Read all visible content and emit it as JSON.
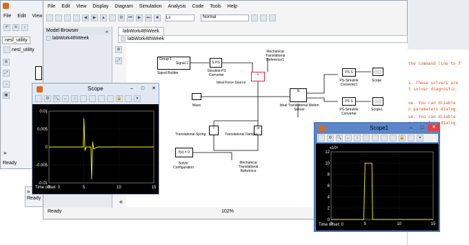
{
  "small_window": {
    "menu": [
      "File",
      "Edit",
      "View"
    ],
    "tab_nesl": "nesl_utility",
    "tree_item": "nesl_utility",
    "status": "Ready"
  },
  "simulink": {
    "menu": [
      "File",
      "Edit",
      "View",
      "Display",
      "Diagram",
      "Simulation",
      "Analysis",
      "Code",
      "Tools",
      "Help"
    ],
    "sim_time": "Ls",
    "sim_mode": "Normal",
    "model_browser_title": "Model Browser",
    "browser_item": "labWork4thWeek",
    "tab": "labWork4thWeek",
    "breadcrumb": "labWork4thWeek",
    "status": "Ready",
    "zoom": "102%",
    "blocks": {
      "group_label": "Group 1",
      "signal_label": "Signal 1",
      "signal_builder": "Signal Builder",
      "s_ps": "S PS",
      "s_ps_conv": "Simulink-PS Converter",
      "mech_ref1": "Mechanical Translational Reference1",
      "ideal_force": "Ideal Force Source",
      "mass": "Mass",
      "sensor": "Ideal Translational Motion Sensor",
      "ps_s1": "PS S",
      "ps_s1_conv": "PS-Simulink Converter1",
      "ps_s2": "PS S",
      "ps_s2_conv": "PS-Simulink Converter",
      "scope": "Scope",
      "scope1": "Scope1",
      "spring": "Translational Spring",
      "damper": "Translational Damper",
      "fx": "f(x) = 0",
      "solver": "Solver Configuration",
      "mech_ref": "Mechanical Translational Reference"
    }
  },
  "console": {
    "lines": [
      {
        "text": "the command line to f",
        "top": 89
      },
      {
        "text": "s. These solvers are",
        "top": 117
      },
      {
        "text": "t solver diagnostic",
        "top": 126
      },
      {
        "text": "ue.  You can disable",
        "top": 146
      },
      {
        "text": "n parameters dialog",
        "top": 155
      },
      {
        "text": "ue.  You can disable",
        "top": 166
      },
      {
        "text": "n parameters dialog",
        "top": 175
      }
    ],
    "gray_line": "ie.  You can disable"
  },
  "scope": {
    "title": "Scope",
    "yticks": [
      "0.01",
      "0.005",
      "0",
      "-0.005",
      "-0.01"
    ],
    "xticks": [
      "0",
      "5",
      "10",
      "15"
    ],
    "time_offset": "Time offset:  0"
  },
  "scope1": {
    "title": "Scope1",
    "exponent": "x10⁴",
    "yticks": [
      "12",
      "10",
      "8",
      "6",
      "4",
      "2",
      "0"
    ],
    "xticks": [
      "0",
      "5",
      "10",
      "15"
    ],
    "time_offset": "Time offset:  0"
  },
  "colors": {
    "scope_bg": "#000000",
    "trace": "#ffff00",
    "scope1_frame": "#5b86c9",
    "close": "#e04343"
  }
}
